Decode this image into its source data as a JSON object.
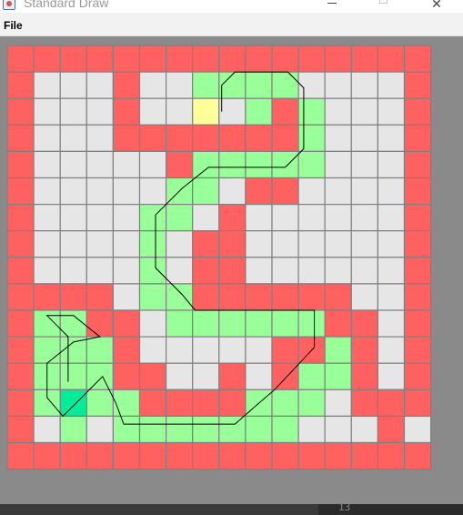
{
  "window": {
    "title": "Standard Draw",
    "minimize_icon": "minimize-icon",
    "maximize_icon": "maximize-icon",
    "close_glyph": "✕"
  },
  "menubar": {
    "items": [
      {
        "label": "File"
      }
    ]
  },
  "colors": {
    "background": "#8a8a8a",
    "wall": "#ff6060",
    "floor": "#e6e6e6",
    "path": "#99ff99",
    "start": "#ffff99",
    "goal": "#00ee99",
    "grid_line": "#808080",
    "route_line": "#000000"
  },
  "maze": {
    "rows": 16,
    "cols": 16,
    "legend": {
      "W": "wall",
      ".": "floor",
      "P": "path",
      "S": "start",
      "G": "goal"
    },
    "grid": [
      "WWWWWWWWWWWWWWWW",
      "W...W..PPPP....W",
      "W...W..S.PWP...W",
      "W...WWWWWWWP...W",
      "W.....WPPPPP...W",
      "W.....PP.WW....W",
      "W....PP.W......W",
      "W....P.WW......W",
      "W....P.WW......W",
      "WWWW.PPWWWWWW..W",
      "WPPWW.PPPPPPWW.W",
      "WPPPW.....WWPW.W",
      "WPPPWW..W.WPPW.W",
      "WPGPPWWWWPPP.WWW",
      "W.P.PPPPPPP...W.W",
      "WWWWWWWWWWWWWWWW"
    ]
  },
  "route": {
    "description_points_cells": [
      [
        8.1,
        2.5
      ],
      [
        8.1,
        1.5
      ],
      [
        8.6,
        1.0
      ],
      [
        10.6,
        1.0
      ],
      [
        11.2,
        1.6
      ],
      [
        11.2,
        3.9
      ],
      [
        10.5,
        4.6
      ],
      [
        7.6,
        4.6
      ],
      [
        6.6,
        5.4
      ],
      [
        5.6,
        6.4
      ],
      [
        5.6,
        8.4
      ],
      [
        6.6,
        9.4
      ],
      [
        7.1,
        10.0
      ],
      [
        11.6,
        10.0
      ],
      [
        11.6,
        11.4
      ],
      [
        10.1,
        13.0
      ],
      [
        9.4,
        13.6
      ],
      [
        8.6,
        14.3
      ],
      [
        4.4,
        14.3
      ],
      [
        4.1,
        13.5
      ],
      [
        3.6,
        12.5
      ],
      [
        2.6,
        13.5
      ],
      [
        2.1,
        14.0
      ],
      [
        1.5,
        13.3
      ],
      [
        1.5,
        12.0
      ],
      [
        2.5,
        11.2
      ],
      [
        3.5,
        11.0
      ],
      [
        3.0,
        10.6
      ],
      [
        2.5,
        10.2
      ],
      [
        1.5,
        10.2
      ],
      [
        2.3,
        11.0
      ],
      [
        2.3,
        12.7
      ]
    ]
  },
  "taskbar": {
    "text": "13"
  }
}
